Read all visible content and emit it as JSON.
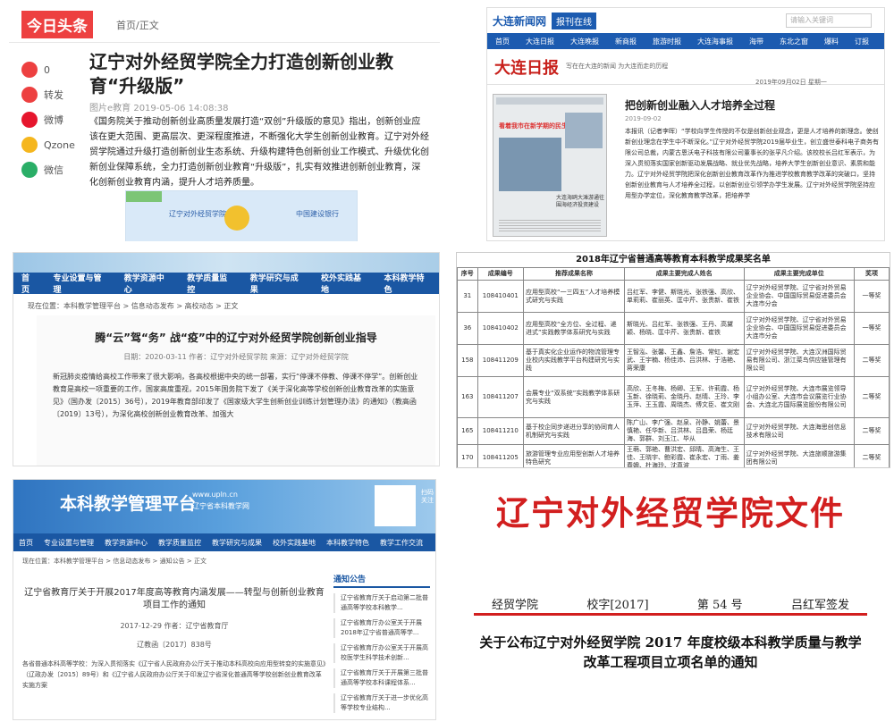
{
  "toutiao": {
    "logo": "今日头条",
    "crumb": "首页/正文",
    "side": [
      {
        "label": "0",
        "icon": "comment-icon",
        "color": "#ed4040"
      },
      {
        "label": "转发",
        "icon": "repost-icon",
        "color": "#ed4040"
      },
      {
        "label": "微博",
        "icon": "weibo-icon",
        "color": "#e6162d"
      },
      {
        "label": "Qzone",
        "icon": "qzone-icon",
        "color": "#f5b61e"
      },
      {
        "label": "微信",
        "icon": "wechat-icon",
        "color": "#2aae67"
      }
    ],
    "title": "辽宁对外经贸学院全力打造创新创业教育“升级版”",
    "meta": "图片e教育 2019-05-06 14:08:38",
    "body": "《国务院关于推动创新创业高质量发展打造“双创”升级版的意见》指出，创新创业应该在更大范围、更高层次、更深程度推进，不断强化大学生创新创业教育。辽宁对外经贸学院通过升级打造创新创业生态系统、升级构建特色创新创业工作模式、升级优化创新创业保障系统，全力打造创新创业教育“升级版”，扎实有效推进创新创业教育，深化创新创业教育内涵，提升人才培养质量。",
    "img_logo1": "辽宁对外经贸学院",
    "img_logo2": "中国建设银行"
  },
  "dalian": {
    "logo": "大连新闻网",
    "tag": "报刊在线",
    "search_placeholder": "请输入关键词",
    "nav": [
      "首页",
      "大连日报",
      "大连晚报",
      "新商报",
      "旅游时报",
      "大连海事报",
      "海带",
      "东北之窗",
      "爆料",
      "订报"
    ],
    "brand": "大连日报",
    "brand_sub": "写在在大连的新闻 为大连而走的历程",
    "date": "2019年09月02日 星期一",
    "paper_headline": "看着我市在新学期的民生工程！",
    "paper_caption": "大连海鸥大滩游通往围海经济投资建设",
    "article_title": "把创新创业融入人才培养全过程",
    "article_date": "2019-09-02",
    "article_body": "本报讯（记者李晖）“学校向学生传授的不仅是创新创业观念，更是人才培养的新理念。使创新创业理念在学生中不断深化。”辽宁对外经贸学院2019届毕业生，创立盛世泰科电子商务有限公司总裁，内蒙古恩沃电子科技有限公司董事长的张孚凡介绍。该校校长吕红军表示，为深入贯彻落实国家创新驱动发展战略、就业优先战略，培养大学生创新创业意识、素质和能力。辽宁对外经贸学院把深化创新创业教育改革作为推进学校教育教学改革的突破口，坚持创新创业教育与人才培养全过程，以创新创业引领学办学生发展。辽宁对外经贸学院坚持应用型办学定位，深化教育教学改革，把培养学"
  },
  "nkzx": {
    "nav": [
      "首页",
      "专业设置与管理",
      "教学资源中心",
      "教学质量监控",
      "教学研究与成果",
      "校外实践基地",
      "本科教学特色"
    ],
    "crumb": "现在位置：本科教学管理平台 > 信息动态发布 > 高校动态 > 正文",
    "title": "腾“云”驾“务” 战“疫”中的辽宁对外经贸学院创新创业指导",
    "meta": "日期：2020-03-11  作者：辽宁对外经贸学院  来源：辽宁对外经贸学院",
    "body": "新冠肺炎疫情给高校工作带来了很大影响，各高校根据中央的统一部署，实行“停课不停教、停课不停学”。创新创业教育是高校一项重要的工作，国家高度重视，2015年国务院下发了《关于深化高等学校创新创业教育改革的实施意见》（国办发〔2015〕36号），2019年教育部印发了《国家级大学生创新创业训练计划管理办法》的通知》（教高函〔2019〕13号），为深化高校创新创业教育改革、加强大"
  },
  "award": {
    "title": "2018年辽宁省普通高等教育本科教学成果奖名单",
    "headers": [
      "序号",
      "成果编号",
      "推荐成果名称",
      "成果主要完成人姓名",
      "成果主要完成单位",
      "奖项"
    ],
    "rows": [
      [
        "31",
        "108410401",
        "应用型高校“一三四五”人才培养模式研究与实践",
        "吕红军、李健、斯晓光、张铁强、高欣、单莉莉、崔丽英、匡中芹、张贵新、崔铁",
        "辽宁对外经贸学院、辽宁省对外贸易企业协会、中国国际贸易促进委员会大连市分会",
        "一等奖"
      ],
      [
        "36",
        "108410402",
        "应用型高校“全方位、全过程、递进式”实践教学体系研究与实践",
        "斯晓光、吕红军、张铁强、王丹、高黛颖、杨晓、匡中芹、张贵新、崔铁",
        "辽宁对外经贸学院、辽宁省对外贸易企业协会、中国国际贸易促进委员会大连市分会",
        "一等奖"
      ],
      [
        "158",
        "108411209",
        "基于真实化企业运作的物流管理专业校内实践教学平台构建研究与实践",
        "王智泓、张馨、王鑫、詹浩、常虹、谢宏武、王宇楠、杨佳沛、吕洪林、于浩艳、蒋荣康",
        "辽宁对外经贸学院、大连汉洲国际贸易有限公司、浙江菜鸟供应链管理有限公司",
        "二等奖"
      ],
      [
        "163",
        "108411207",
        "会展专业“双系统”实践教学体系研究与实践",
        "高欣、王冬梅、杨卿、王军、许莉霞、杨玉新、徐晓莉、金晓丹、赵晴、王玲、李玉萍、王玉霞、周晓杰、傅文臣、崔文刚",
        "辽宁对外经贸学院、大连市展览领导小组办公室、大连市会议展览行业协会、大连北方国际展览股份有限公司",
        "二等奖"
      ],
      [
        "165",
        "108411210",
        "基于校企同步递进分享的协同育人机制研究与实践",
        "陈广山、李广强、赵泉、孙静、姚蕾、景慎艳、任华新、吕洪林、吕昌荣、杨廷海、郭群、刘玉江、毕从",
        "辽宁对外经贸学院、大连海思创信息技术有限公司",
        "二等奖"
      ],
      [
        "170",
        "108411205",
        "旅游管理专业应用型创新人才培养特色研究",
        "王萌、郭艳、曹洪宏、邱晴、高海生、王佳、王晓宇、鲍彩霞、崔永宏、丁雨、姜春娥、杜海玲、沈真波",
        "辽宁对外经贸学院、大连旅顺旅游集团有限公司",
        "二等奖"
      ]
    ]
  },
  "upln": {
    "title": "本科教学管理平台",
    "url": "www.upln.cn",
    "sub": "辽宁省本科教学网",
    "qr_label": "扫码关注",
    "nav": [
      "首页",
      "专业设置与管理",
      "教学资源中心",
      "教学质量监控",
      "教学研究与成果",
      "校外实践基地",
      "本科教学特色",
      "教学工作交流"
    ],
    "crumb": "现在位置：本科教学管理平台 > 信息动态发布 > 通知公告 > 正文",
    "article_title": "辽宁省教育厅关于开展2017年度高等教育内涵发展——转型与创新创业教育项目工作的通知",
    "article_date": "2017-12-29  作者：辽宁省教育厅",
    "doc_no": "辽教函〔2017〕838号",
    "body": "各省普通本科高等学校：为深入贯彻落实《辽宁省人民政府办公厅关于推动本科高校向应用型转变的实施意见》（辽政办发〔2015〕89号）和《辽宁省人民政府办公厅关于印发辽宁省深化普通高等学校创新创业教育改革实施方案",
    "side_title": "通知公告",
    "side_items": [
      "辽宁省教育厅关于启动第二批普通高等学校本科教学...",
      "辽宁省教育厅办公室关于开展2018年辽宁省普通高等学...",
      "辽宁省教育厅办公室关于开展高校医学生科学技术创新...",
      "辽宁省教育厅关于开展第三批普通高等学校本科课程体系...",
      "辽宁省教育厅关于进一步优化高等学校专业结构..."
    ]
  },
  "doc": {
    "header": "辽宁对外经贸学院文件",
    "issuer": "经贸学院",
    "ref": "校字[2017]",
    "num": "第 54 号",
    "signer": "吕红军签发",
    "title": "关于公布辽宁对外经贸学院 2017 年度校级本科教学质量与教学改革工程项目立项名单的通知"
  }
}
